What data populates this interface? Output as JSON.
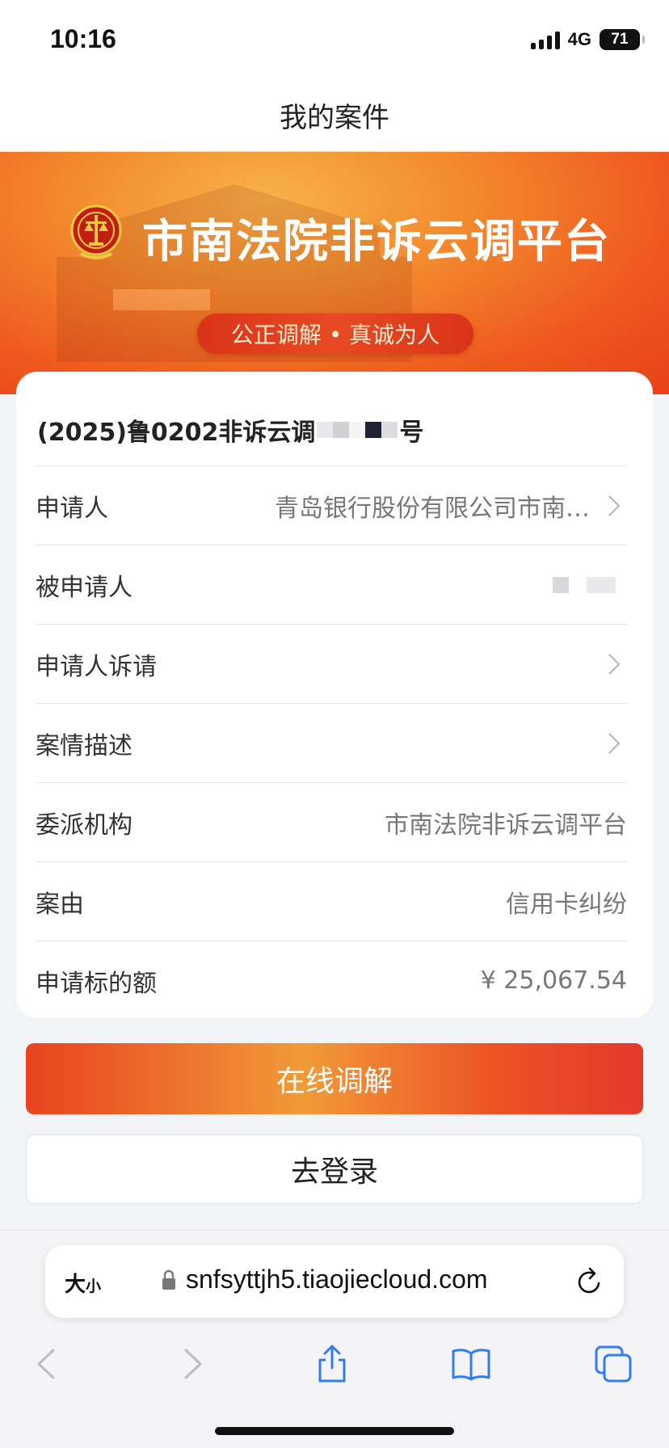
{
  "status_bar": {
    "time": "10:16",
    "network": "4G",
    "battery": "71"
  },
  "nav": {
    "title": "我的案件"
  },
  "banner": {
    "title": "市南法院非诉云调平台",
    "slogan": "公正调解 • 真诚为人"
  },
  "case": {
    "number_prefix": "(2025)鲁0202非诉云调",
    "number_suffix": "号",
    "rows": [
      {
        "label": "申请人",
        "value": "青岛银行股份有限公司市南…"
      },
      {
        "label": "被申请人",
        "value": ""
      },
      {
        "label": "申请人诉请",
        "value": ""
      },
      {
        "label": "案情描述",
        "value": ""
      },
      {
        "label": "委派机构",
        "value": "市南法院非诉云调平台"
      },
      {
        "label": "案由",
        "value": "信用卡纠纷"
      },
      {
        "label": "申请标的额",
        "value": "¥ 25,067.54"
      }
    ]
  },
  "actions": {
    "primary": "在线调解",
    "secondary": "去登录"
  },
  "browser": {
    "text_size_big": "大",
    "text_size_small": "小",
    "url": "snfsyttjh5.tiaojiecloud.com"
  },
  "colors": {
    "accent_orange": "#f19a38",
    "accent_red": "#e8431f",
    "banner_red": "#ef5a1e"
  }
}
